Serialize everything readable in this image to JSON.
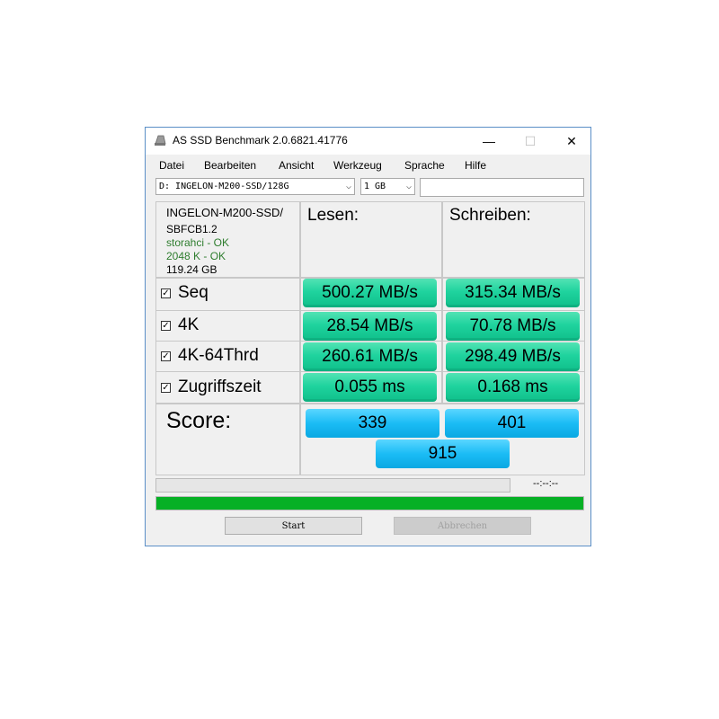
{
  "window": {
    "title": "AS SSD Benchmark 2.0.6821.41776",
    "minimize": "—",
    "maximize": "☐",
    "close": "✕"
  },
  "menu": [
    "Datei",
    "Bearbeiten",
    "Ansicht",
    "Werkzeug",
    "Sprache",
    "Hilfe"
  ],
  "toolbar": {
    "drive_select": "D: INGELON-M200-SSD/128G",
    "size_select": "1 GB",
    "text_value": ""
  },
  "drive_info": {
    "model": "INGELON-M200-SSD/",
    "firmware": "SBFCB1.2",
    "driver": "storahci - OK",
    "alignment": "2048 K - OK",
    "capacity": "119.24 GB"
  },
  "columns": {
    "read": "Lesen:",
    "write": "Schreiben:"
  },
  "rows": [
    {
      "checked": true,
      "label": "Seq",
      "read": "500.27 MB/s",
      "write": "315.34 MB/s"
    },
    {
      "checked": true,
      "label": "4K",
      "read": "28.54 MB/s",
      "write": "70.78 MB/s"
    },
    {
      "checked": true,
      "label": "4K-64Thrd",
      "read": "260.61 MB/s",
      "write": "298.49 MB/s"
    },
    {
      "checked": true,
      "label": "Zugriffszeit",
      "read": "0.055 ms",
      "write": "0.168 ms"
    }
  ],
  "score": {
    "label": "Score:",
    "read": "339",
    "write": "401",
    "total": "915"
  },
  "progress": {
    "time": "--:--:--",
    "top_fraction": 0,
    "bottom_fraction": 1.0
  },
  "buttons": {
    "start": "Start",
    "abort": "Abbrechen"
  },
  "colors": {
    "result_green": "#1fd39e",
    "score_blue": "#1bbcf5",
    "progress_green": "#06b025",
    "status_ok": "#2e7d2e"
  },
  "icons": {
    "title": "drive-icon",
    "checkbox": "check-icon"
  }
}
